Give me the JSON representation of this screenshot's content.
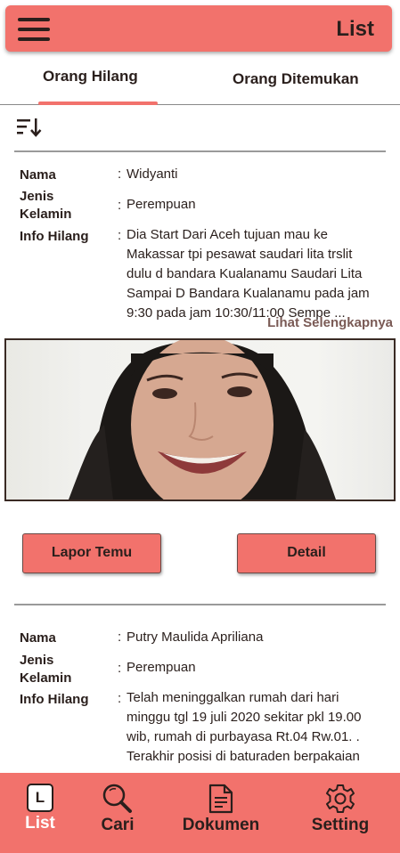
{
  "appbar": {
    "title": "List",
    "menu_icon": "hamburger-menu-icon"
  },
  "tabs": [
    {
      "label": "Orang Hilang",
      "active": true
    },
    {
      "label": "Orang Ditemukan",
      "active": false
    }
  ],
  "sort_icon": "sort-descending-icon",
  "labels": {
    "name": "Nama",
    "gender_line1": "Jenis",
    "gender_line2": "Kelamin",
    "info": "Info Hilang",
    "colon": ":"
  },
  "records": [
    {
      "name": "Widyanti",
      "gender": "Perempuan",
      "info_lines": [
        "Dia Start Dari Aceh tujuan mau ke",
        "Makassar tpi pesawat saudari lita trslit",
        "dulu d bandara Kualanamu Saudari Lita",
        "Sampai D Bandara Kualanamu pada jam",
        "9:30 pada jam 10:30/11:00 Sempe ..."
      ],
      "see_more": "Lihat Selengkapnya",
      "report_button": "Lapor Temu",
      "detail_button": "Detail"
    },
    {
      "name": "Putry Maulida Apriliana",
      "gender": "Perempuan",
      "info_lines": [
        "Telah meninggalkan rumah dari hari",
        "minggu tgl 19 juli 2020 sekitar pkl 19.00",
        "wib, rumah di purbayasa Rt.04 Rw.01. .",
        "Terakhir posisi di baturaden berpakaian"
      ]
    }
  ],
  "bottom_nav": [
    {
      "label": "List",
      "icon": "list-L-icon",
      "active": true,
      "glyph": "L"
    },
    {
      "label": "Cari",
      "icon": "search-icon",
      "active": false
    },
    {
      "label": "Dokumen",
      "icon": "document-icon",
      "active": false
    },
    {
      "label": "Setting",
      "icon": "gear-icon",
      "active": false
    }
  ],
  "colors": {
    "accent": "#f2726c",
    "text": "#2a1f1c",
    "active_nav_text": "#ffffff"
  }
}
